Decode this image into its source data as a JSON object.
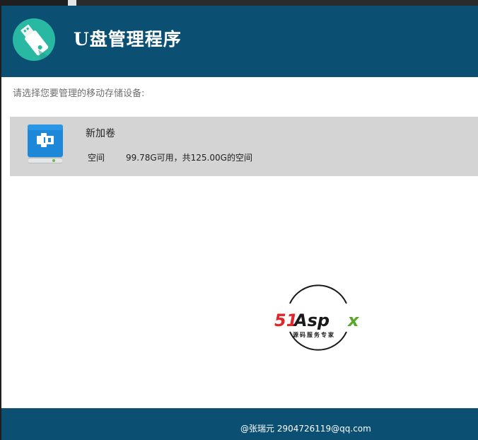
{
  "header": {
    "title": "U盘管理程序",
    "logo_icon": "usb-drive-icon"
  },
  "prompt": "请选择您要管理的移动存储设备:",
  "devices": [
    {
      "name": "新加卷",
      "space_label": "空间",
      "space_value": "99.78G可用，共125.00G的空间",
      "icon": "usb-storage-icon"
    }
  ],
  "watermark": {
    "brand": "51Aspx",
    "subtitle": "源码服务专家"
  },
  "footer": {
    "text": "@张瑞元 2904726119@qq.com"
  },
  "colors": {
    "header_bg": "#0b4f72",
    "logo_bg": "#29b9a3",
    "card_bg": "#d4d4d4",
    "device_icon_blue": "#1e88d8",
    "watermark_red": "#e0262b",
    "watermark_green": "#5aa72a"
  }
}
